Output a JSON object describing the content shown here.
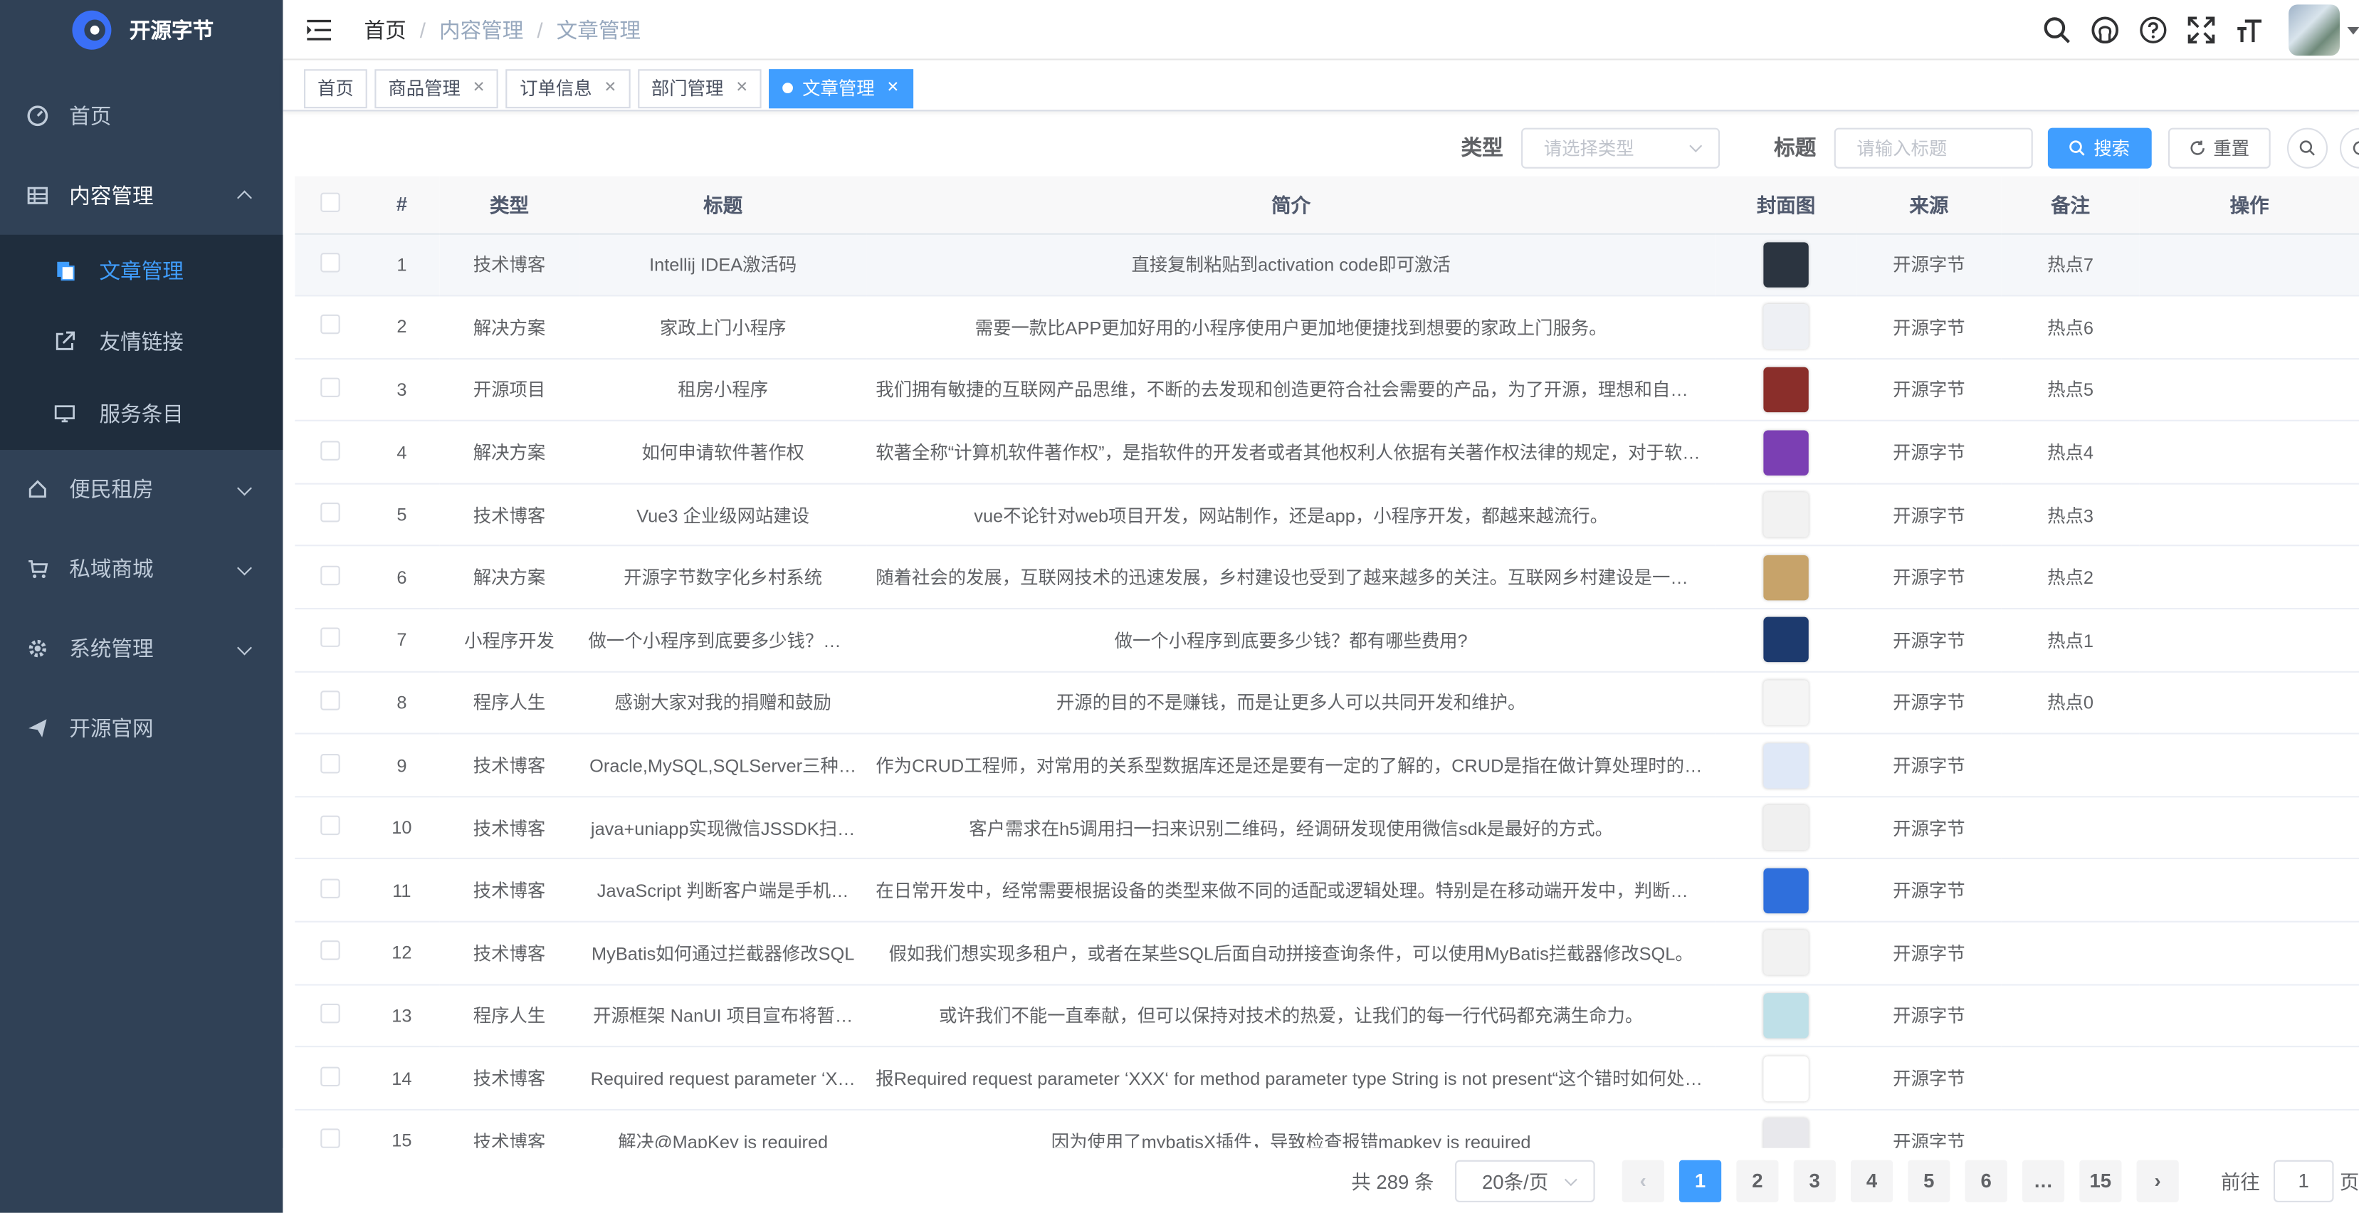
{
  "app": {
    "name": "开源字节"
  },
  "sidebar": {
    "items": [
      {
        "label": "首页",
        "icon": "dashboard-icon"
      },
      {
        "label": "内容管理",
        "icon": "table-icon",
        "children": [
          {
            "label": "文章管理",
            "icon": "documents-icon",
            "active": true
          },
          {
            "label": "友情链接",
            "icon": "external-link-icon"
          },
          {
            "label": "服务条目",
            "icon": "monitor-icon"
          }
        ]
      },
      {
        "label": "便民租房",
        "icon": "house-icon"
      },
      {
        "label": "私域商城",
        "icon": "cart-icon"
      },
      {
        "label": "系统管理",
        "icon": "gear-icon"
      },
      {
        "label": "开源官网",
        "icon": "paper-plane-icon"
      }
    ]
  },
  "breadcrumb": [
    "首页",
    "内容管理",
    "文章管理"
  ],
  "tags": [
    {
      "label": "首页"
    },
    {
      "label": "商品管理"
    },
    {
      "label": "订单信息"
    },
    {
      "label": "部门管理"
    },
    {
      "label": "文章管理",
      "active": true
    }
  ],
  "search": {
    "type_label": "类型",
    "type_placeholder": "请选择类型",
    "title_label": "标题",
    "title_placeholder": "请输入标题",
    "search_btn": "搜索",
    "reset_btn": "重置"
  },
  "table": {
    "columns": [
      "#",
      "类型",
      "标题",
      "简介",
      "封面图",
      "来源",
      "备注",
      "操作"
    ],
    "rows": [
      {
        "no": "1",
        "type": "技术博客",
        "title": "Intellij IDEA激活码",
        "intro": "直接复制粘贴到activation code即可激活",
        "source": "开源字节",
        "note": "热点7"
      },
      {
        "no": "2",
        "type": "解决方案",
        "title": "家政上门小程序",
        "intro": "需要一款比APP更加好用的小程序使用户更加地便捷找到想要的家政上门服务。",
        "source": "开源字节",
        "note": "热点6"
      },
      {
        "no": "3",
        "type": "开源项目",
        "title": "租房小程序",
        "intro": "我们拥有敏捷的互联网产品思维，不断的去发现和创造更符合社会需要的产品，为了开源，理想和自由不懈…",
        "source": "开源字节",
        "note": "热点5"
      },
      {
        "no": "4",
        "type": "解决方案",
        "title": "如何申请软件著作权",
        "intro": "软著全称“计算机软件著作权”，是指软件的开发者或者其他权利人依据有关著作权法律的规定，对于软件作…",
        "source": "开源字节",
        "note": "热点4"
      },
      {
        "no": "5",
        "type": "技术博客",
        "title": "Vue3 企业级网站建设",
        "intro": "vue不论针对web项目开发，网站制作，还是app，小程序开发，都越来越流行。",
        "source": "开源字节",
        "note": "热点3"
      },
      {
        "no": "6",
        "type": "解决方案",
        "title": "开源字节数字化乡村系统",
        "intro": "随着社会的发展，互联网技术的迅速发展，乡村建设也受到了越来越多的关注。互联网乡村建设是一种新型…",
        "source": "开源字节",
        "note": "热点2"
      },
      {
        "no": "7",
        "type": "小程序开发",
        "title": "做一个小程序到底要多少钱？都…",
        "intro": "做一个小程序到底要多少钱？都有哪些费用?",
        "source": "开源字节",
        "note": "热点1"
      },
      {
        "no": "8",
        "type": "程序人生",
        "title": "感谢大家对我的捐赠和鼓励",
        "intro": "开源的目的不是赚钱，而是让更多人可以共同开发和维护。",
        "source": "开源字节",
        "note": "热点0"
      },
      {
        "no": "9",
        "type": "技术博客",
        "title": "Oracle,MySQL,SQLServer三种…",
        "intro": "作为CRUD工程师，对常用的关系型数据库还是还是要有一定的了解的，CRUD是指在做计算处理时的增加(…",
        "source": "开源字节",
        "note": ""
      },
      {
        "no": "10",
        "type": "技术博客",
        "title": "java+uniapp实现微信JSSDK扫…",
        "intro": "客户需求在h5调用扫一扫来识别二维码，经调研发现使用微信sdk是最好的方式。",
        "source": "开源字节",
        "note": ""
      },
      {
        "no": "11",
        "type": "技术博客",
        "title": "JavaScript 判断客户端是手机…",
        "intro": "在日常开发中，经常需要根据设备的类型来做不同的适配或逻辑处理。特别是在移动端开发中，判断用户使…",
        "source": "开源字节",
        "note": ""
      },
      {
        "no": "12",
        "type": "技术博客",
        "title": "MyBatis如何通过拦截器修改SQL",
        "intro": "假如我们想实现多租户，或者在某些SQL后面自动拼接查询条件，可以使用MyBatis拦截器修改SQL。",
        "source": "开源字节",
        "note": ""
      },
      {
        "no": "13",
        "type": "程序人生",
        "title": "开源框架 NanUI 项目宣布将暂…",
        "intro": "或许我们不能一直奉献，但可以保持对技术的热爱，让我们的每一行代码都充满生命力。",
        "source": "开源字节",
        "note": ""
      },
      {
        "no": "14",
        "type": "技术博客",
        "title": "Required request parameter ‘X…",
        "intro": "报Required request parameter ‘XXX‘ for method parameter type String is not present“这个错时如何处理。",
        "source": "开源字节",
        "note": ""
      },
      {
        "no": "15",
        "type": "技术博客",
        "title": "解决@MapKey is required",
        "intro": "因为使用了mybatisX插件，导致检查报错mapkey is required",
        "source": "开源字节",
        "note": ""
      }
    ]
  },
  "pagination": {
    "total_text": "共 289 条",
    "page_size": "20条/页",
    "pages": [
      "1",
      "2",
      "3",
      "4",
      "5",
      "6",
      "…",
      "15"
    ],
    "current": "1",
    "goto_label": "前往",
    "goto_value": "1",
    "goto_suffix": "页"
  },
  "colors": {
    "sidebar_bg": "#304156",
    "accent": "#409eff"
  },
  "thumb_colors": [
    "#2b3440",
    "#eef0f4",
    "#8a2e2a",
    "#7b3fb3",
    "#f2f2f2",
    "#c7a36a",
    "#1d3a6e",
    "#f5f5f5",
    "#dfe8f7",
    "#f0f0f0",
    "#2f6fdc",
    "#f2f2f2",
    "#bfe0e8",
    "#ffffff",
    "#e8e8ec"
  ]
}
